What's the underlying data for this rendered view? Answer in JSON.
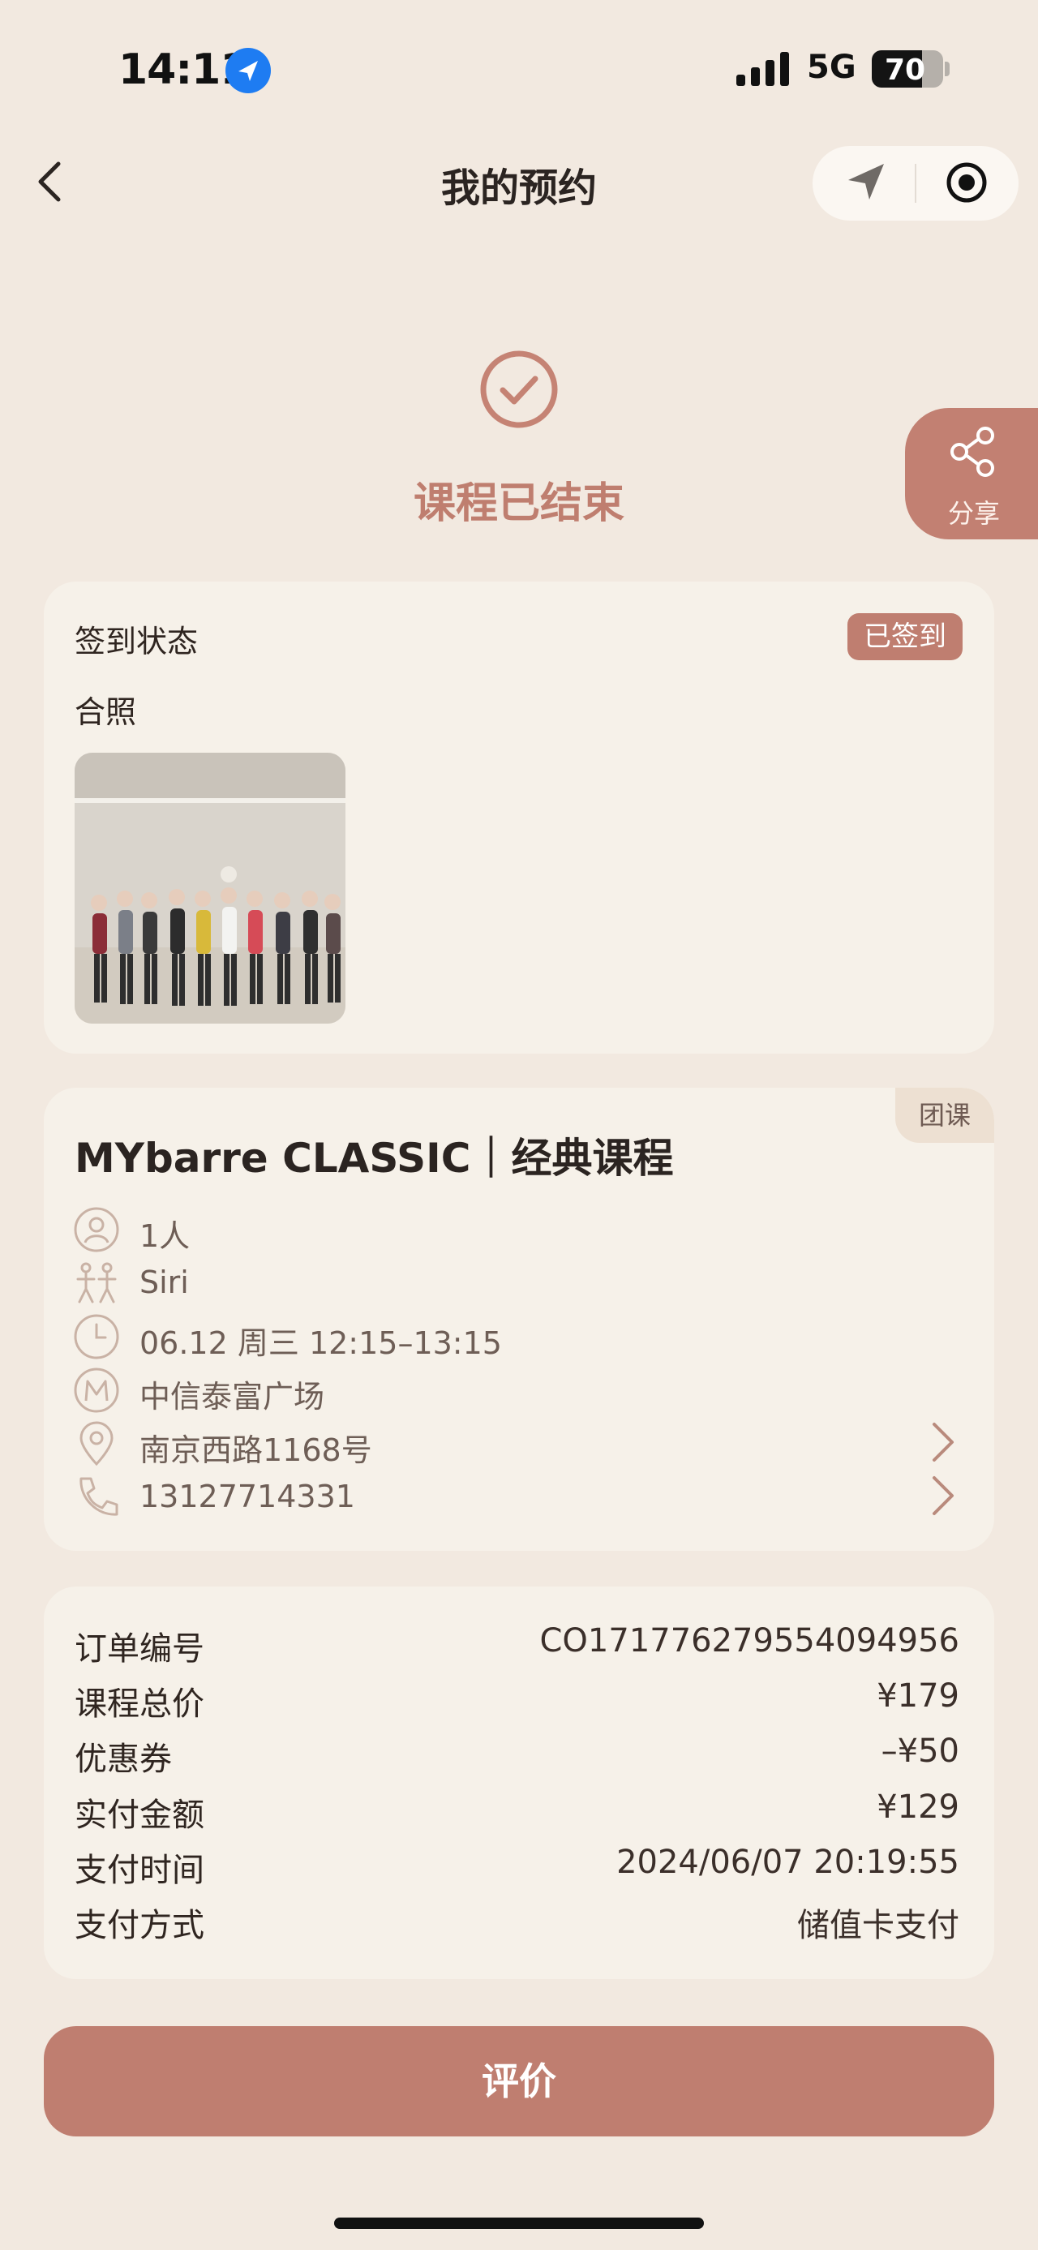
{
  "status_bar": {
    "time": "14:11",
    "network": "5G",
    "battery": "70",
    "battery_level": 0.7
  },
  "nav": {
    "title": "我的预约"
  },
  "status": {
    "title": "课程已结束"
  },
  "share": {
    "label": "分享"
  },
  "checkin": {
    "label": "签到状态",
    "badge": "已签到",
    "photo_label": "合照"
  },
  "course": {
    "tag": "团课",
    "title": "MYbarre CLASSIC｜经典课程",
    "people": "1人",
    "coach": "Siri",
    "time": "06.12 周三 12:15–13:15",
    "studio": "中信泰富广场",
    "address": "南京西路1168号",
    "phone": "13127714331"
  },
  "order": {
    "rows": [
      {
        "label": "订单编号",
        "value": "CO171776279554094956"
      },
      {
        "label": "课程总价",
        "value": "¥179"
      },
      {
        "label": "优惠券",
        "value": "–¥50"
      },
      {
        "label": "实付金额",
        "value": "¥129"
      },
      {
        "label": "支付时间",
        "value": "2024/06/07 20:19:55"
      },
      {
        "label": "支付方式",
        "value": "储值卡支付"
      }
    ]
  },
  "action": {
    "review_label": "评价"
  },
  "colors": {
    "accent": "#bf7e70",
    "background": "#f2e9e0",
    "card": "#f6f1e9"
  }
}
